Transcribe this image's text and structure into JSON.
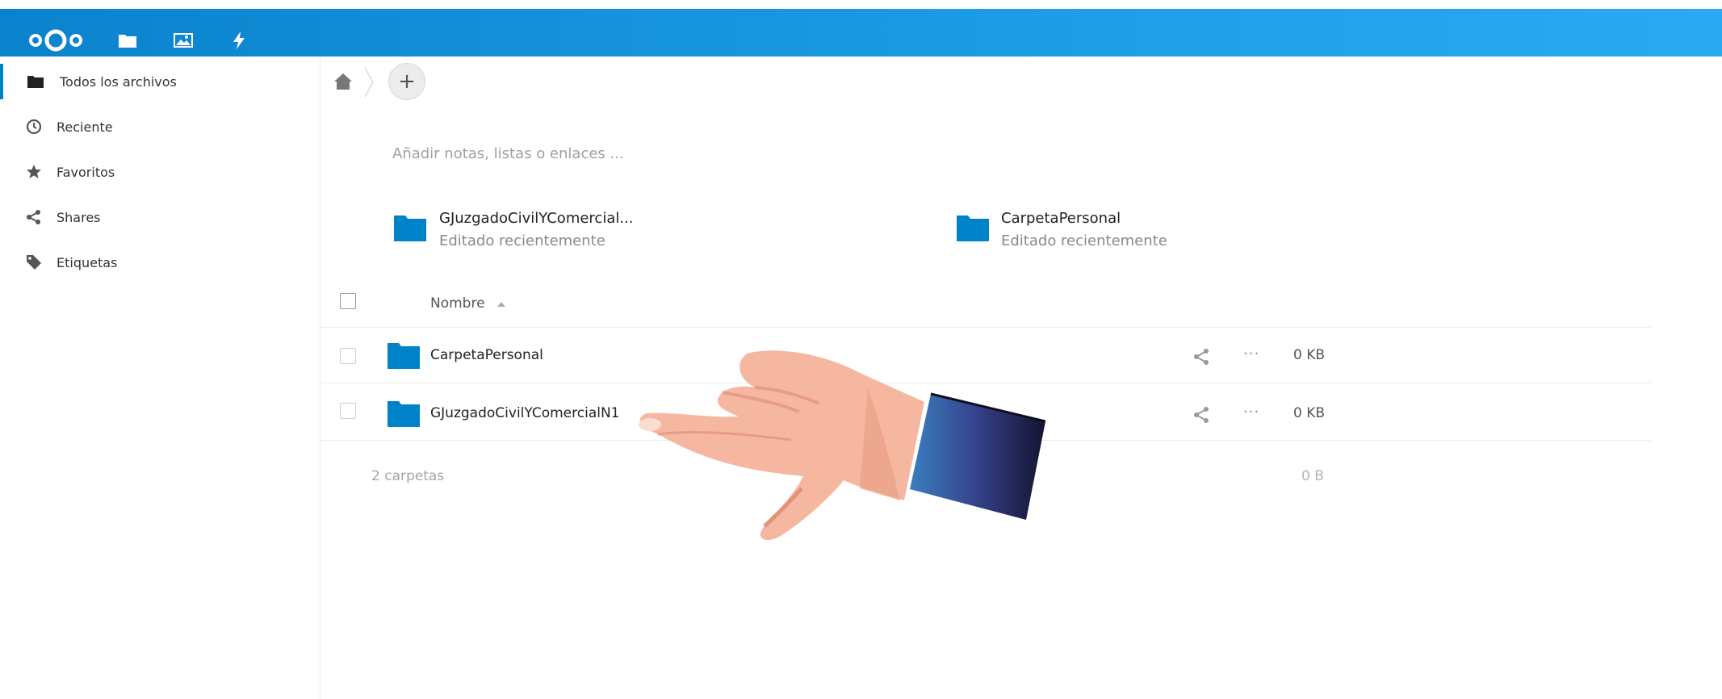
{
  "sidebar": {
    "items": [
      {
        "label": "Todos los archivos",
        "icon": "folder-icon",
        "active": true
      },
      {
        "label": "Reciente",
        "icon": "clock-icon"
      },
      {
        "label": "Favoritos",
        "icon": "star-icon"
      },
      {
        "label": "Shares",
        "icon": "share-icon"
      },
      {
        "label": "Etiquetas",
        "icon": "tag-icon"
      }
    ]
  },
  "toolbar": {
    "add_label": "+"
  },
  "notes": {
    "placeholder": "Añadir notas, listas o enlaces ..."
  },
  "recent": [
    {
      "name": "GJuzgadoCivilYComercial...",
      "status": "Editado recientemente"
    },
    {
      "name": "CarpetaPersonal",
      "status": "Editado recientemente"
    }
  ],
  "list": {
    "column_name": "Nombre",
    "rows": [
      {
        "name": "CarpetaPersonal",
        "more": "···",
        "size": "0 KB"
      },
      {
        "name": "GJuzgadoCivilYComercialN1",
        "more": "···",
        "size": "0 KB"
      }
    ],
    "summary": {
      "count": "2 carpetas",
      "total": "0 B"
    }
  },
  "colors": {
    "header_start": "#0b82cc",
    "header_end": "#2aaaf2",
    "folder": "#0082c9"
  }
}
